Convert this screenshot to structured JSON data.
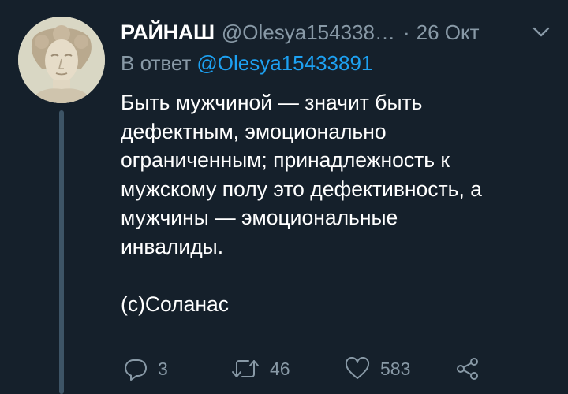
{
  "tweet": {
    "display_name": "РАЙНАШ",
    "handle": "@Olesya154338…",
    "separator": "·",
    "time": "26 Окт",
    "reply_prefix": "В ответ",
    "reply_handle": "@Olesya15433891",
    "text": "Быть мужчиной — значит быть\nдефектным, эмоционально\nограниченным; принадлежность к\nмужскому полу это дефективность, а\nмужчины — эмоциональные\nинвалиды.\n\n(c)Соланас"
  },
  "actions": {
    "reply_count": "3",
    "retweet_count": "46",
    "like_count": "583"
  },
  "icons": {
    "avatar": "classical-bust-avatar",
    "menu": "chevron-down-icon",
    "reply": "reply-icon",
    "retweet": "retweet-icon",
    "like": "heart-icon",
    "share": "share-icon"
  },
  "colors": {
    "background": "#15202b",
    "secondary_text": "#8899a6",
    "link": "#1da1f2",
    "thread_line": "#3d5466"
  }
}
